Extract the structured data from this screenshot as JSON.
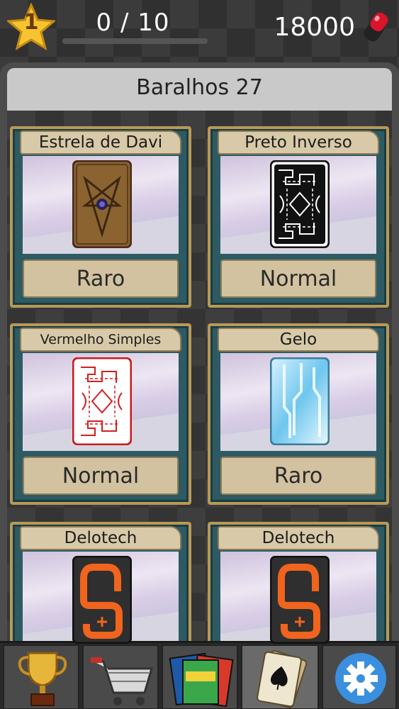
{
  "header": {
    "level": "1",
    "xp_text": "0 / 10",
    "xp_progress": 0,
    "coins": "18000"
  },
  "panel": {
    "title": "Baralhos 27"
  },
  "decks": [
    {
      "name": "Estrela de Davi",
      "rarity": "Raro",
      "style": "wood-pentagram"
    },
    {
      "name": "Preto Inverso",
      "rarity": "Normal",
      "style": "black-pattern"
    },
    {
      "name": "Vermelho Simples",
      "rarity": "Normal",
      "style": "red-pattern"
    },
    {
      "name": "Gelo",
      "rarity": "Raro",
      "style": "ice"
    },
    {
      "name": "Delotech",
      "rarity": "",
      "style": "delotech"
    },
    {
      "name": "Delotech",
      "rarity": "",
      "style": "delotech"
    }
  ],
  "tabs": [
    {
      "name": "trophy-icon",
      "active": false
    },
    {
      "name": "shopping-cart-icon",
      "active": false
    },
    {
      "name": "truco-packs-icon",
      "active": false
    },
    {
      "name": "deck-cards-icon",
      "active": true
    },
    {
      "name": "settings-gear-icon",
      "active": false
    }
  ],
  "colors": {
    "accent_gold": "#b89956",
    "card_frame": "#2d5a63",
    "tab_active": "#6a6a6a"
  }
}
